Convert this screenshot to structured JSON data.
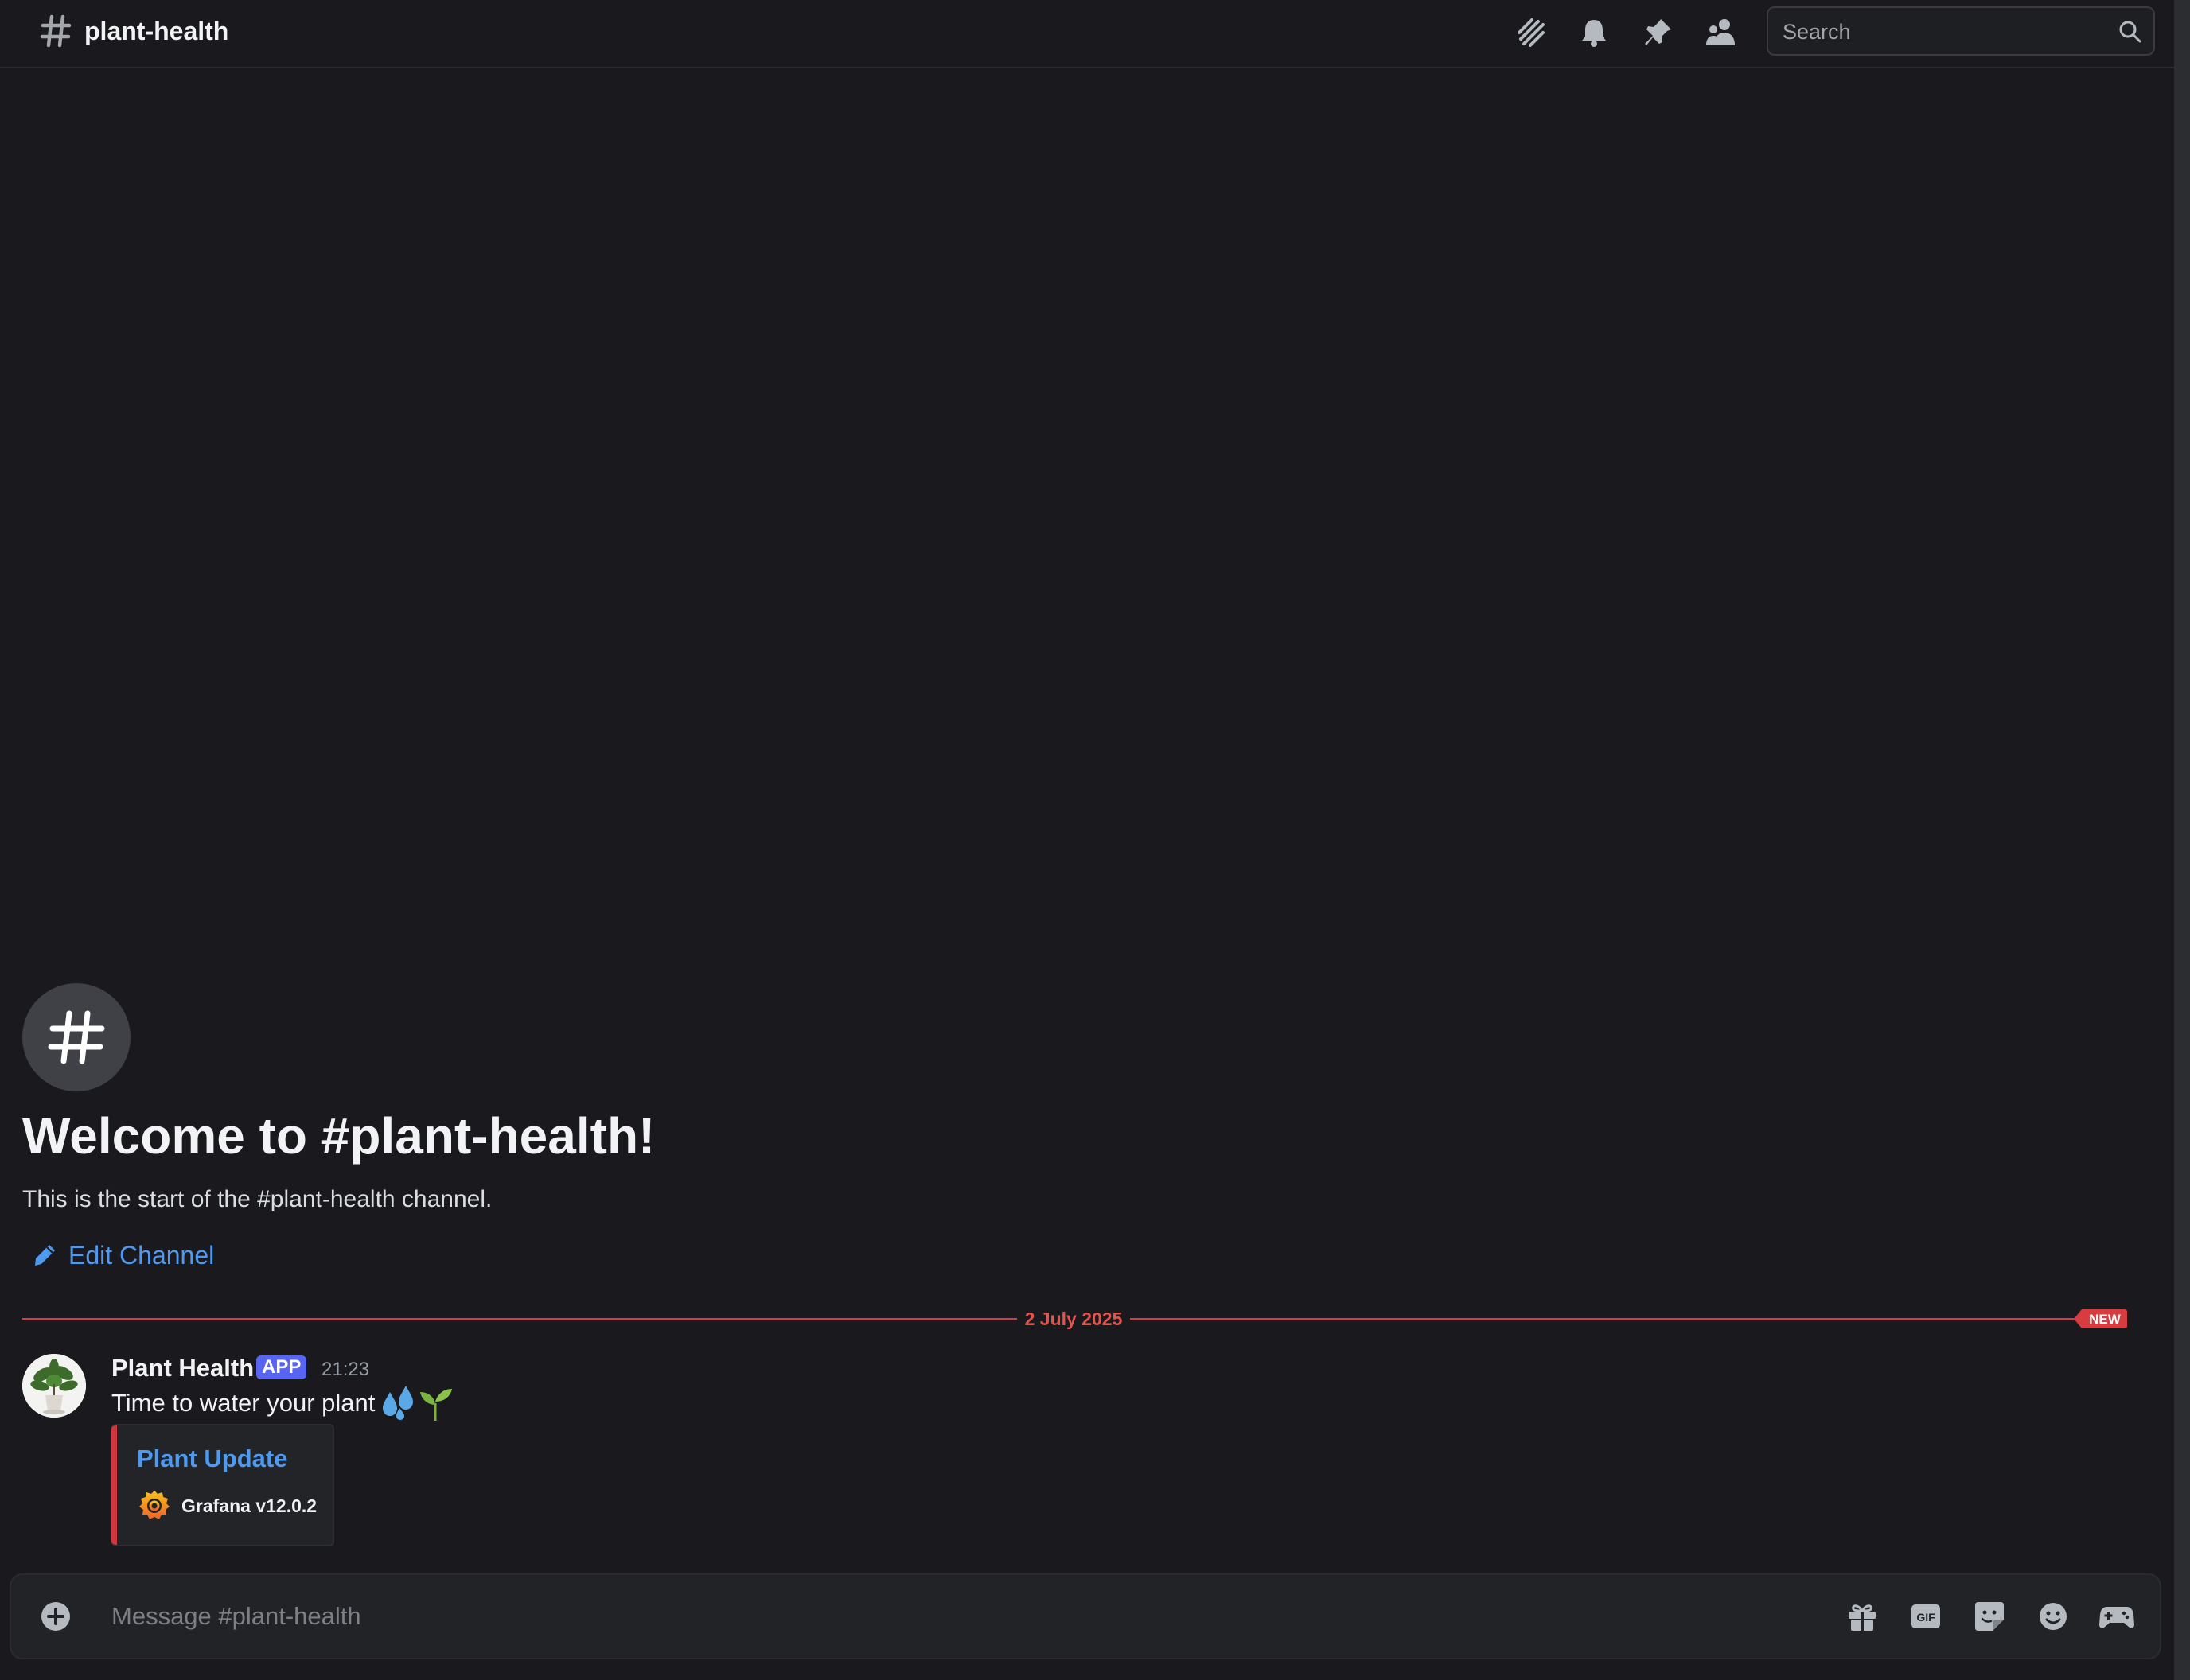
{
  "header": {
    "channel_name": "plant-health",
    "search_placeholder": "Search",
    "icons": [
      "threads-icon",
      "bell-icon",
      "pin-icon",
      "members-icon",
      "search-icon"
    ]
  },
  "welcome": {
    "title": "Welcome to #plant-health!",
    "subtitle": "This is the start of the #plant-health channel.",
    "edit_label": "Edit Channel"
  },
  "divider": {
    "date": "2 July 2025",
    "badge": "NEW"
  },
  "message": {
    "author": "Plant Health",
    "tag": "APP",
    "time": "21:23",
    "text": "Time to water your plant",
    "emoji": [
      "droplets",
      "seedling"
    ],
    "embed": {
      "title": "Plant Update",
      "footer": "Grafana v12.0.2",
      "accent_color": "#d1383d"
    }
  },
  "composer": {
    "placeholder": "Message #plant-health",
    "icons": [
      "gift-icon",
      "gif-icon",
      "sticker-icon",
      "emoji-icon",
      "gamepad-icon"
    ]
  },
  "colors": {
    "background": "#1a1a1e",
    "link": "#4e9af0",
    "new_divider": "#d83c3e",
    "app_tag": "#5865f2"
  }
}
